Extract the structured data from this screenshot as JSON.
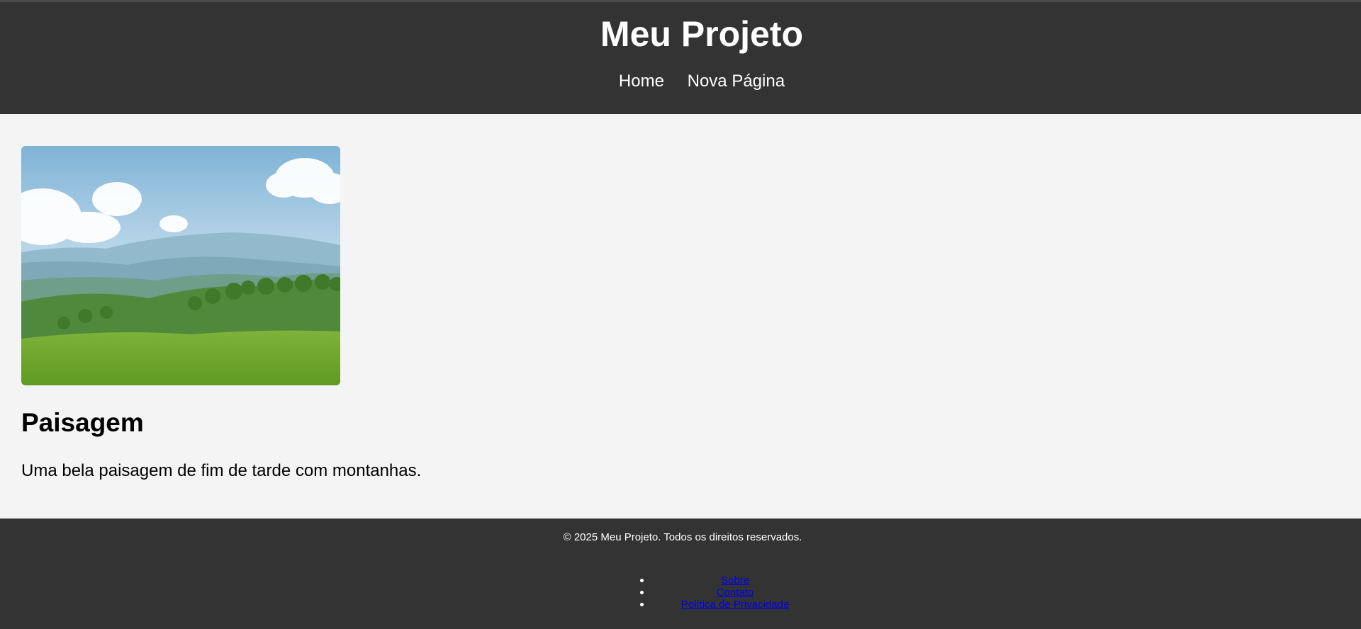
{
  "header": {
    "title": "Meu Projeto",
    "nav": [
      {
        "label": "Home"
      },
      {
        "label": "Nova Página"
      }
    ]
  },
  "card": {
    "image_icon": "landscape-image",
    "title": "Paisagem",
    "description": "Uma bela paisagem de fim de tarde com montanhas."
  },
  "footer": {
    "copyright": "© 2025 Meu Projeto. Todos os direitos reservados.",
    "links": [
      {
        "label": "Sobre"
      },
      {
        "label": "Contato"
      },
      {
        "label": "Política de Privacidade"
      }
    ]
  },
  "colors": {
    "header_bg": "#333333",
    "page_bg": "#f4f4f4",
    "link": "#0000ee"
  }
}
